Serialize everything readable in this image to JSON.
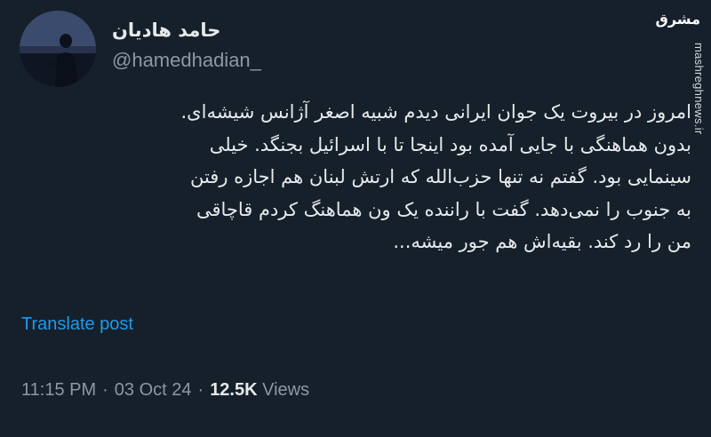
{
  "author": {
    "display_name": "حامد هادیان",
    "handle": "@hamedhadian_"
  },
  "watermark": {
    "logo_text": "مشرق",
    "url": "mashreghnews.ir"
  },
  "tweet": {
    "lines": [
      "امروز در بیروت یک جوان ایرانی دیدم شبیه اصغر آژانس شیشه‌ای.",
      "بدون هماهنگی با جایی آمده بود اینجا تا با اسرائیل بجنگد. خیلی",
      "سینمایی بود. گفتم نه تنها حزب‌الله که ارتش لبنان هم اجازه رفتن",
      "به جنوب را نمی‌دهد. گفت با راننده یک ون هماهنگ کردم قاچاقی",
      "من را رد کند. بقیه‌اش هم جور میشه..."
    ],
    "translate_label": "Translate post"
  },
  "meta": {
    "time": "11:15 PM",
    "separator": "·",
    "date": "03 Oct 24",
    "views_count": "12.5K",
    "views_label": "Views"
  },
  "colors": {
    "background": "#15202b",
    "text": "#e7e9ea",
    "muted": "#8b98a5",
    "link": "#1d9bf0"
  }
}
